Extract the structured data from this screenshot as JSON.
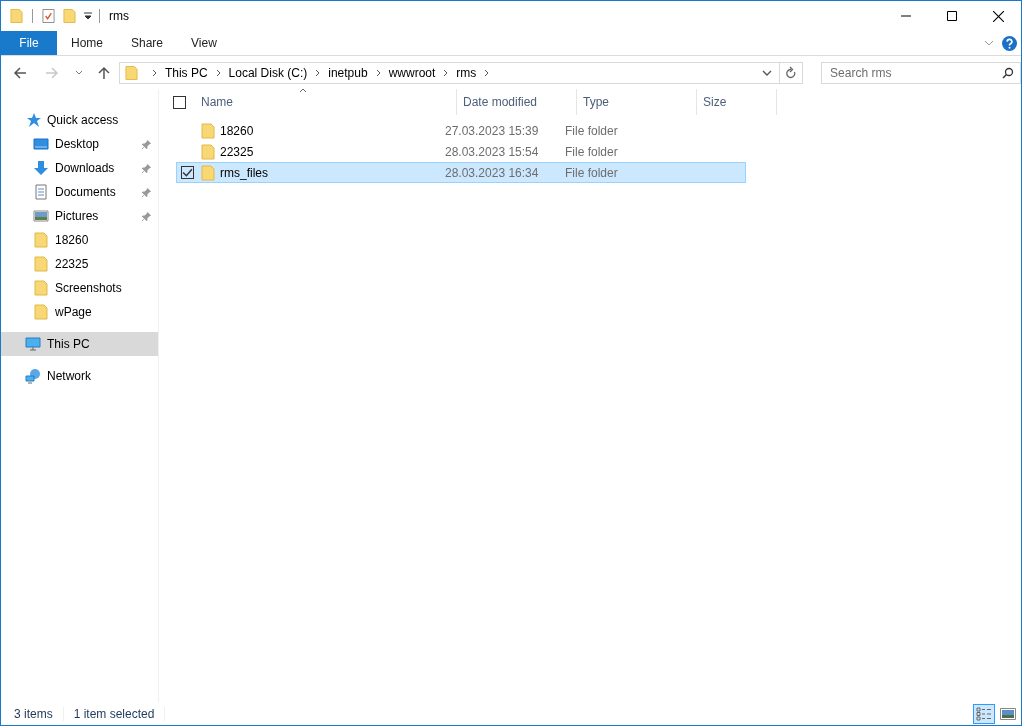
{
  "window": {
    "title": "rms"
  },
  "ribbon": {
    "tabs": [
      {
        "label": "File",
        "selected": true
      },
      {
        "label": "Home",
        "selected": false
      },
      {
        "label": "Share",
        "selected": false
      },
      {
        "label": "View",
        "selected": false
      }
    ]
  },
  "address": {
    "crumbs": [
      "This PC",
      "Local Disk (C:)",
      "inetpub",
      "wwwroot",
      "rms"
    ],
    "search": {
      "placeholder": "Search rms"
    }
  },
  "sidebar": {
    "items": [
      {
        "label": "Quick access",
        "kind": "star",
        "selected": false,
        "children": [
          {
            "label": "Desktop",
            "kind": "desktop",
            "pinned": true,
            "selected": false
          },
          {
            "label": "Downloads",
            "kind": "download",
            "pinned": true,
            "selected": false
          },
          {
            "label": "Documents",
            "kind": "document",
            "pinned": true,
            "selected": false
          },
          {
            "label": "Pictures",
            "kind": "pictures",
            "pinned": true,
            "selected": false
          },
          {
            "label": "18260",
            "kind": "folder",
            "pinned": false,
            "selected": false
          },
          {
            "label": "22325",
            "kind": "folder",
            "pinned": false,
            "selected": false
          },
          {
            "label": "Screenshots",
            "kind": "folder",
            "pinned": false,
            "selected": false
          },
          {
            "label": "wPage",
            "kind": "folder",
            "pinned": false,
            "selected": false
          }
        ]
      },
      {
        "label": "This PC",
        "kind": "pc",
        "selected": true
      },
      {
        "label": "Network",
        "kind": "network",
        "selected": false
      }
    ]
  },
  "table": {
    "select_all": {
      "checked": false
    },
    "columns": [
      "Name",
      "Date modified",
      "Type",
      "Size"
    ],
    "rows": [
      {
        "name": "18260",
        "date": "27.03.2023 15:39",
        "type": "File folder",
        "selected": false,
        "checked": false
      },
      {
        "name": "22325",
        "date": "28.03.2023 15:54",
        "type": "File folder",
        "selected": false,
        "checked": false
      },
      {
        "name": "rms_files",
        "date": "28.03.2023 16:34",
        "type": "File folder",
        "selected": true,
        "checked": true
      }
    ]
  },
  "status_bar": {
    "items": "3 items",
    "selected": "1 item selected"
  }
}
